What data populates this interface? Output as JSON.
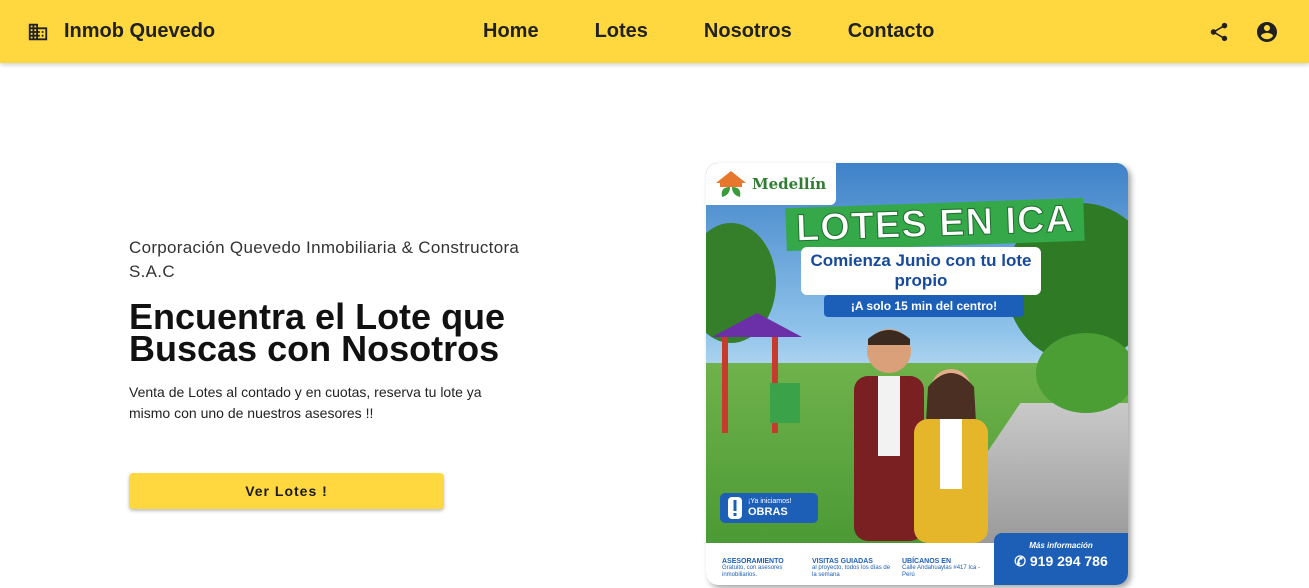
{
  "header": {
    "brand": "Inmob Quevedo",
    "nav": [
      "Home",
      "Lotes",
      "Nosotros",
      "Contacto"
    ],
    "icons": {
      "brand": "building-icon",
      "share": "share-icon",
      "account": "account-circle-icon"
    }
  },
  "hero": {
    "company": "Corporación Quevedo Inmobiliaria & Constructora S.A.C",
    "headline": "Encuentra el Lote que Buscas con Nosotros",
    "description": "Venta de Lotes al contado y en cuotas, reserva tu lote ya mismo con uno de nuestros asesores !!",
    "cta": "Ver Lotes !"
  },
  "promo": {
    "logo": "Medellín",
    "title": "LOTES EN ICA",
    "subtitle": "Comienza Junio con tu lote propio",
    "tagline": "¡A solo 15 min del centro!",
    "badge_small": "¡Ya iniciamos!",
    "badge_big": "OBRAS",
    "features": [
      {
        "title": "ASESORAMIENTO",
        "text": "Gratuito, con asesores inmobiliarios."
      },
      {
        "title": "VISITAS GUIADAS",
        "text": "al proyecto, todos los días de la semana"
      },
      {
        "title": "UBÍCANOS EN",
        "text": "Calle Andahuaylas #417 Ica - Perú"
      }
    ],
    "info_label": "Más información",
    "phone": "919 294 786"
  },
  "colors": {
    "accent": "#ffd83f",
    "promo_blue": "#1d5eb7",
    "promo_green": "#35a84a"
  }
}
